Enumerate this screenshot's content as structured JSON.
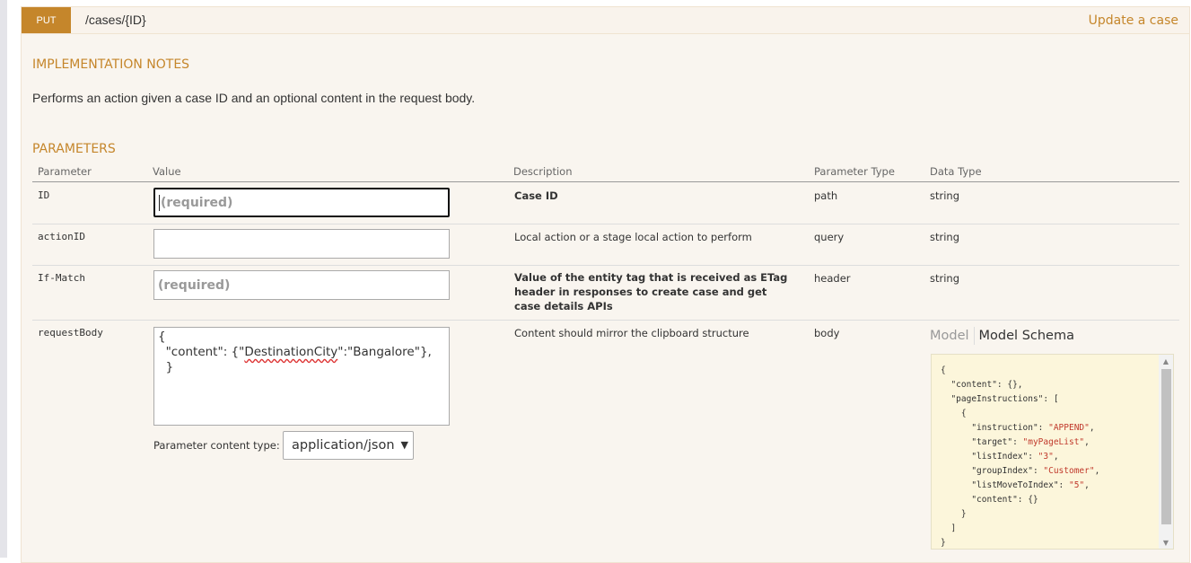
{
  "operation": {
    "method": "PUT",
    "path": "/cases/{ID}",
    "summary": "Update a case"
  },
  "implementation_notes": {
    "title": "IMPLEMENTATION NOTES",
    "text": "Performs an action given a case ID and an optional content in the request body."
  },
  "parameters": {
    "title": "PARAMETERS",
    "headers": {
      "parameter": "Parameter",
      "value": "Value",
      "description": "Description",
      "parameter_type": "Parameter Type",
      "data_type": "Data Type"
    },
    "rows": [
      {
        "name": "ID",
        "placeholder": "(required)",
        "description": "Case ID",
        "param_type": "path",
        "data_type": "string"
      },
      {
        "name": "actionID",
        "placeholder": "",
        "description": "Local action or a stage local action to perform",
        "param_type": "query",
        "data_type": "string"
      },
      {
        "name": "If-Match",
        "placeholder": "(required)",
        "description": "Value of the entity tag that is received as ETag header in responses to create case and get case details APIs",
        "param_type": "header",
        "data_type": "string"
      },
      {
        "name": "requestBody",
        "description": "Content should mirror the clipboard structure",
        "param_type": "body"
      }
    ],
    "request_body": {
      "line1": "{",
      "line2_prefix": "  \"content\": {\"",
      "line2_spell": "DestinationCity",
      "line2_suffix": "\":\"Bangalore\"},",
      "line3": "  }"
    },
    "content_type_label": "Parameter content type:",
    "content_type_value": "application/json",
    "model_tab": "Model",
    "model_schema_tab": "Model Schema",
    "schema": {
      "l1": "{",
      "l2": "  \"content\": {},",
      "l3": "  \"pageInstructions\": [",
      "l4": "    {",
      "l5k": "      \"instruction\": ",
      "l5v": "\"APPEND\"",
      "l5e": ",",
      "l6k": "      \"target\": ",
      "l6v": "\"myPageList\"",
      "l6e": ",",
      "l7k": "      \"listIndex\": ",
      "l7v": "\"3\"",
      "l7e": ",",
      "l8k": "      \"groupIndex\": ",
      "l8v": "\"Customer\"",
      "l8e": ",",
      "l9k": "      \"listMoveToIndex\": ",
      "l9v": "\"5\"",
      "l9e": ",",
      "l10": "      \"content\": {}",
      "l11": "    }",
      "l12": "  ]",
      "l13": "}"
    }
  }
}
